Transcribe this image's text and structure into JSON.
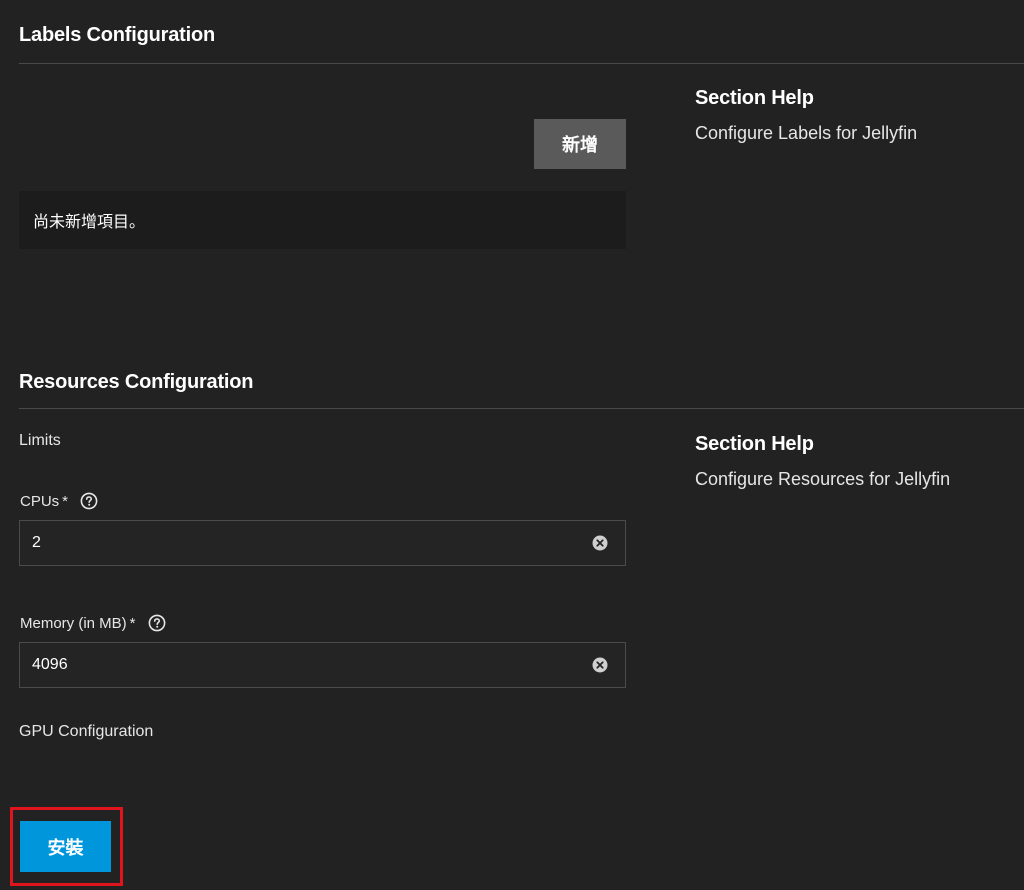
{
  "labels_section": {
    "title": "Labels Configuration",
    "help_title": "Section Help",
    "help_text": "Configure Labels for Jellyfin",
    "add_button": "新增",
    "empty_message": "尚未新增項目。"
  },
  "resources_section": {
    "title": "Resources Configuration",
    "help_title": "Section Help",
    "help_text": "Configure Resources for Jellyfin",
    "limits_label": "Limits",
    "cpus": {
      "label": "CPUs",
      "required_mark": "*",
      "value": "2"
    },
    "memory": {
      "label": "Memory (in MB)",
      "required_mark": "*",
      "value": "4096"
    },
    "gpu_label": "GPU Configuration"
  },
  "footer": {
    "install_button": "安裝"
  },
  "colors": {
    "background": "#222222",
    "accent": "#0096dc",
    "highlight_border": "#e0141c"
  },
  "icons": {
    "help": "help-circle-icon",
    "clear": "clear-circle-icon"
  }
}
